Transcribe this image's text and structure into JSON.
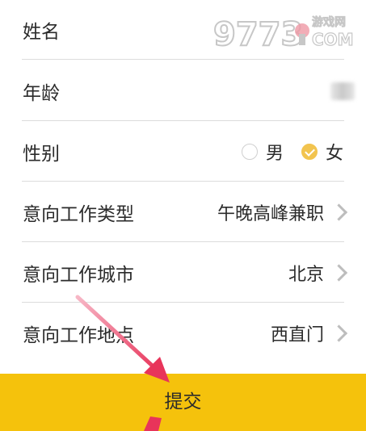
{
  "watermark": {
    "brand_text": "9773",
    "site_text": "游戏网",
    "domain_text": "COM"
  },
  "form": {
    "name_label": "姓名",
    "age_label": "年龄",
    "gender": {
      "label": "性别",
      "options": [
        {
          "label": "男",
          "checked": false
        },
        {
          "label": "女",
          "checked": true
        }
      ]
    },
    "job_type": {
      "label": "意向工作类型",
      "value": "午晚高峰兼职"
    },
    "job_city": {
      "label": "意向工作城市",
      "value": "北京"
    },
    "job_location": {
      "label": "意向工作地点",
      "value": "西直门"
    }
  },
  "submit_label": "提交",
  "colors": {
    "accent": "#f5c20c",
    "radio_checked": "#f2c44f",
    "annotation_arrow": "#e8345a"
  }
}
